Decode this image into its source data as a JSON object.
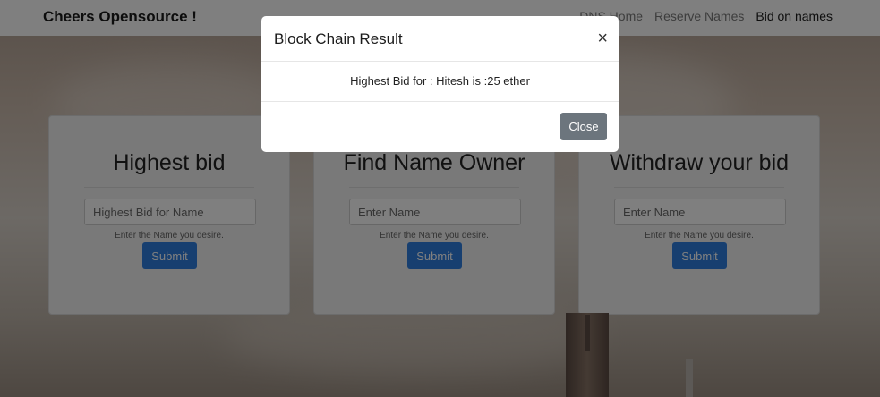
{
  "navbar": {
    "brand": "Cheers Opensource !",
    "links": [
      "DNS Home",
      "Reserve Names",
      "Bid on names"
    ],
    "active_link": "Bid on names"
  },
  "cards": [
    {
      "title": "Highest bid",
      "placeholder": "Highest Bid for Name",
      "help": "Enter the Name you desire.",
      "submit": "Submit"
    },
    {
      "title": "Find Name Owner",
      "placeholder": "Enter Name",
      "help": "Enter the Name you desire.",
      "submit": "Submit"
    },
    {
      "title": "Withdraw your bid",
      "placeholder": "Enter Name",
      "help": "Enter the Name you desire.",
      "submit": "Submit"
    }
  ],
  "modal": {
    "title": "Block Chain Result",
    "close_symbol": "×",
    "body": "Highest Bid for : Hitesh is :25 ether",
    "close_button": "Close"
  },
  "colors": {
    "submit": "#2f7fe0",
    "close_button": "#6c757d",
    "overlay": "rgba(0,0,0,0.5)"
  }
}
